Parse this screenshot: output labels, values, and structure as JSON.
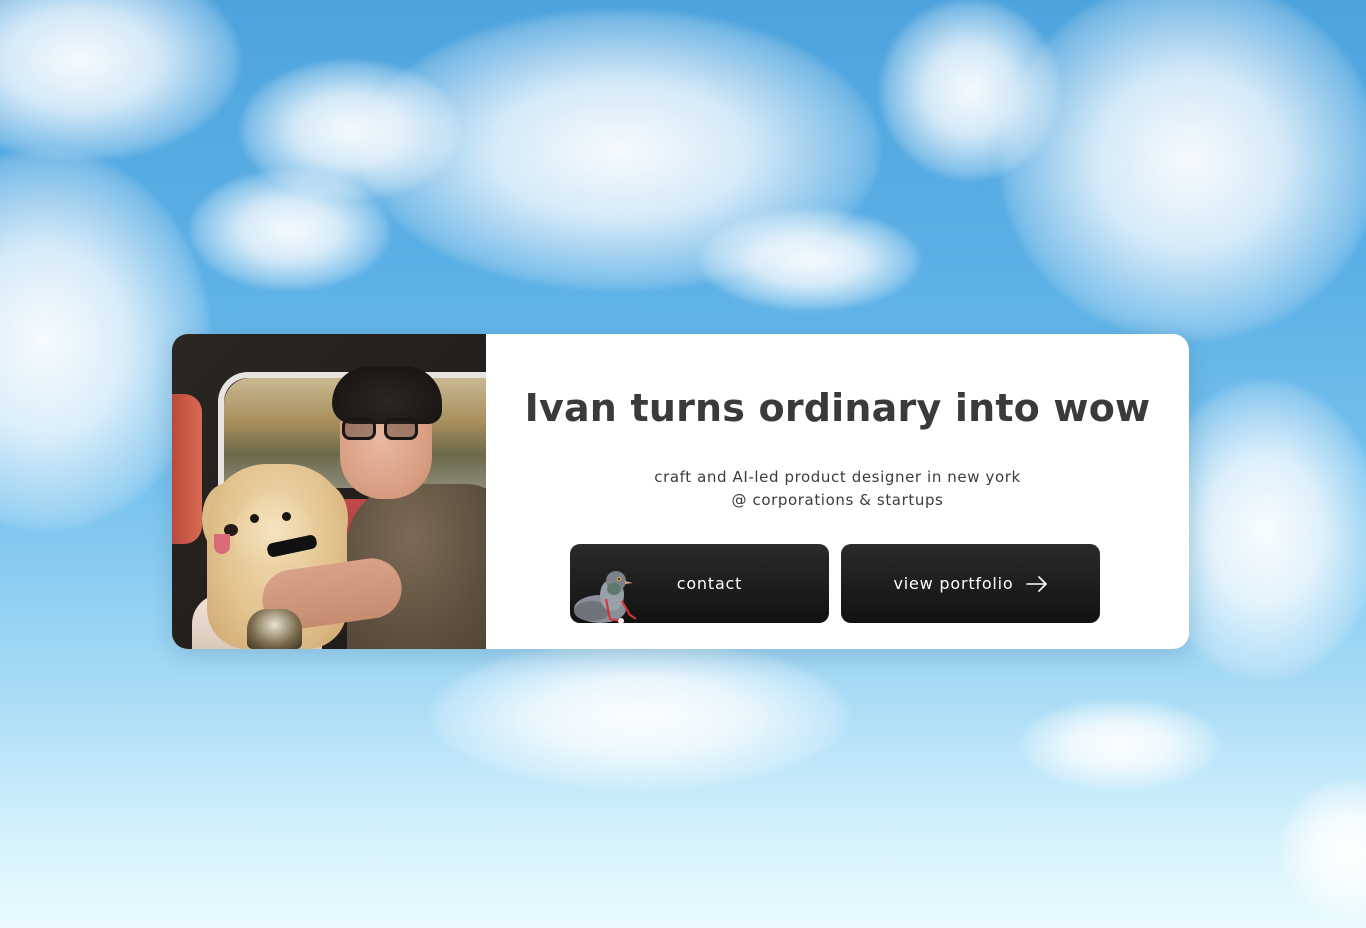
{
  "hero": {
    "title": "Ivan turns ordinary into wow",
    "subtitle_line1": "craft and AI-led product designer in new york",
    "subtitle_line2": "@ corporations & startups"
  },
  "buttons": {
    "contact_label": "contact",
    "portfolio_label": "view portfolio"
  },
  "icons": {
    "contact_icon": "pigeon-icon",
    "portfolio_icon": "arrow-right-icon"
  },
  "colors": {
    "sky_top": "#4ea3dd",
    "sky_bottom": "#e9fbff",
    "card_bg": "#ffffff",
    "title_text": "#3a3a3a",
    "button_bg": "#111111",
    "button_text": "#ffffff"
  }
}
